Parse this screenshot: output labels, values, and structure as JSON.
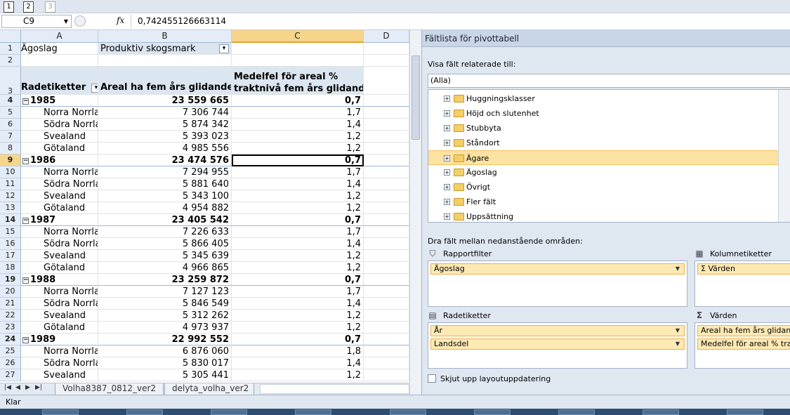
{
  "qat": {
    "keytips": [
      "1",
      "2",
      "3"
    ]
  },
  "formula_bar": {
    "name_box": "C9",
    "fx": "fx",
    "value": "0,742455126663114"
  },
  "columns": [
    "A",
    "B",
    "C",
    "D"
  ],
  "row1": {
    "num": "1",
    "a": "Ägoslag",
    "b": "Produktiv skogsmark"
  },
  "row2": {
    "num": "2"
  },
  "header": {
    "num": "3",
    "a": "Radetiketter",
    "b": "Areal ha fem års glidande",
    "c1": "Medelfel för areal %",
    "c2": "traktnivå fem års glidande"
  },
  "rows": [
    {
      "num": "4",
      "label": "1985",
      "areal": "23 559 665",
      "fel": "0,7",
      "bold": true
    },
    {
      "num": "5",
      "label": "Norra Norrlar",
      "areal": "7 306 744",
      "fel": "1,7"
    },
    {
      "num": "6",
      "label": "Södra Norrla",
      "areal": "5 874 342",
      "fel": "1,4"
    },
    {
      "num": "7",
      "label": "Svealand",
      "areal": "5 393 023",
      "fel": "1,2"
    },
    {
      "num": "8",
      "label": "Götaland",
      "areal": "4 985 556",
      "fel": "1,2"
    },
    {
      "num": "9",
      "label": "1986",
      "areal": "23 474 576",
      "fel": "0,7",
      "bold": true
    },
    {
      "num": "10",
      "label": "Norra Norrlar",
      "areal": "7 294 955",
      "fel": "1,7"
    },
    {
      "num": "11",
      "label": "Södra Norrla",
      "areal": "5 881 640",
      "fel": "1,4"
    },
    {
      "num": "12",
      "label": "Svealand",
      "areal": "5 343 100",
      "fel": "1,2"
    },
    {
      "num": "13",
      "label": "Götaland",
      "areal": "4 954 882",
      "fel": "1,2"
    },
    {
      "num": "14",
      "label": "1987",
      "areal": "23 405 542",
      "fel": "0,7",
      "bold": true
    },
    {
      "num": "15",
      "label": "Norra Norrlar",
      "areal": "7 226 633",
      "fel": "1,7"
    },
    {
      "num": "16",
      "label": "Södra Norrla",
      "areal": "5 866 405",
      "fel": "1,4"
    },
    {
      "num": "17",
      "label": "Svealand",
      "areal": "5 345 639",
      "fel": "1,2"
    },
    {
      "num": "18",
      "label": "Götaland",
      "areal": "4 966 865",
      "fel": "1,2"
    },
    {
      "num": "19",
      "label": "1988",
      "areal": "23 259 872",
      "fel": "0,7",
      "bold": true
    },
    {
      "num": "20",
      "label": "Norra Norrlar",
      "areal": "7 127 123",
      "fel": "1,7"
    },
    {
      "num": "21",
      "label": "Södra Norrla",
      "areal": "5 846 549",
      "fel": "1,4"
    },
    {
      "num": "22",
      "label": "Svealand",
      "areal": "5 312 262",
      "fel": "1,2"
    },
    {
      "num": "23",
      "label": "Götaland",
      "areal": "4 973 937",
      "fel": "1,2"
    },
    {
      "num": "24",
      "label": "1989",
      "areal": "22 992 552",
      "fel": "0,7",
      "bold": true
    },
    {
      "num": "25",
      "label": "Norra Norrlar",
      "areal": "6 876 060",
      "fel": "1,8"
    },
    {
      "num": "26",
      "label": "Södra Norrla",
      "areal": "5 830 017",
      "fel": "1,4"
    },
    {
      "num": "27",
      "label": "Svealand",
      "areal": "5 305 441",
      "fel": "1,2"
    }
  ],
  "selected": {
    "col": "C",
    "row": "9"
  },
  "sheet_tabs": [
    "Volha8387_0812_ver2",
    "delyta_volha_ver2"
  ],
  "pane": {
    "title": "Fältlista för pivottabell",
    "related_label": "Visa fält relaterade till:",
    "related_value": "(Alla)",
    "fields": [
      "Huggningsklasser",
      "Höjd och slutenhet",
      "Stubbyta",
      "Ståndort",
      "Ägare",
      "Ägoslag",
      "Övrigt",
      "Fler fält",
      "Uppsättning"
    ],
    "highlighted_field": "Ägare",
    "drag_label": "Dra fält mellan nedanstående områden:",
    "report_filter": {
      "label": "Rapportfilter",
      "items": [
        "Ägoslag"
      ]
    },
    "column_labels": {
      "label": "Kolumnetiketter",
      "items": [
        "Σ  Värden"
      ]
    },
    "row_labels": {
      "label": "Radetiketter",
      "items": [
        "År",
        "Landsdel"
      ]
    },
    "values": {
      "label": "Värden",
      "items": [
        "Areal ha fem års glidande",
        "Medelfel för areal % traktn"
      ]
    },
    "defer": "Skjut upp layoutuppdatering"
  },
  "status": "Klar"
}
